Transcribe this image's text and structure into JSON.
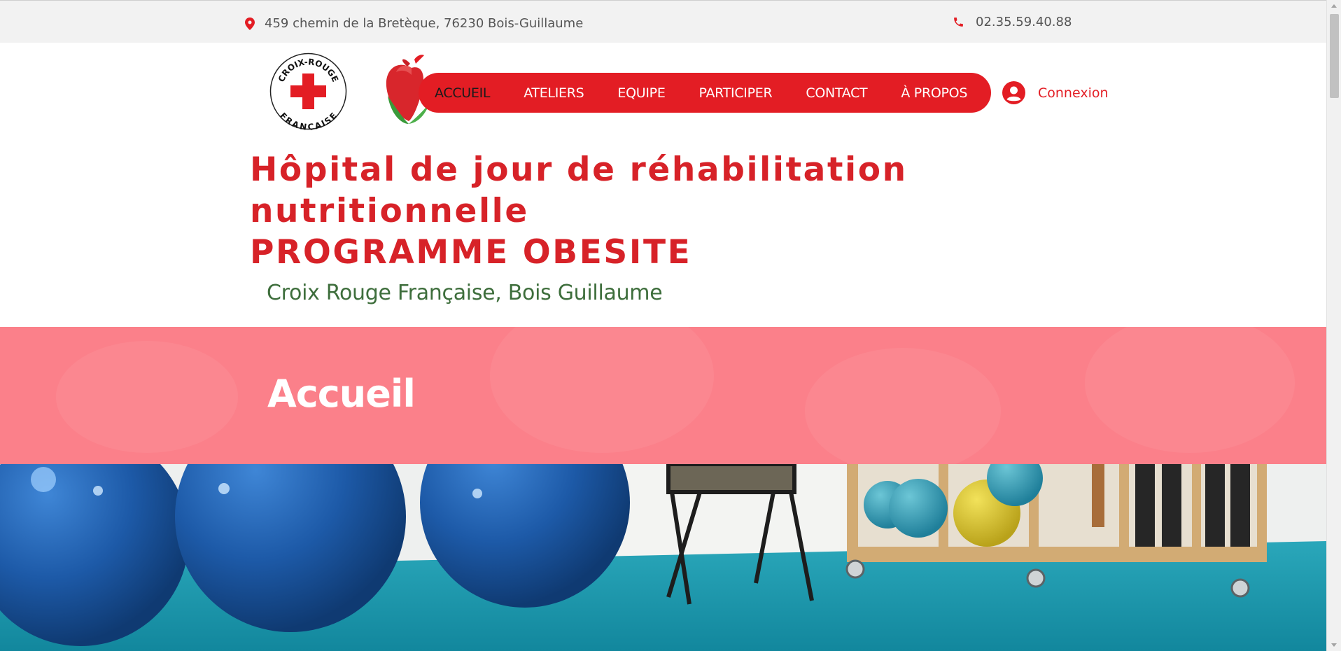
{
  "topbar": {
    "address": "459 chemin de la Bretèque, 76230 Bois-Guillaume",
    "phone": "02.35.59.40.88",
    "address_icon": "map-pin-icon",
    "phone_icon": "phone-icon"
  },
  "logo": {
    "crf_top": "CROIX-ROUGE",
    "crf_bottom": "FRANÇAISE"
  },
  "nav": {
    "items": [
      {
        "label": "ACCUEIL",
        "active": true
      },
      {
        "label": "ATELIERS",
        "active": false
      },
      {
        "label": "EQUIPE",
        "active": false
      },
      {
        "label": "PARTICIPER",
        "active": false
      },
      {
        "label": "CONTACT",
        "active": false
      },
      {
        "label": "À PROPOS",
        "active": false
      }
    ]
  },
  "login": {
    "label": "Connexion",
    "icon": "user-avatar-icon"
  },
  "header": {
    "title_line1": "Hôpital de jour de réhabilitation",
    "title_line2": "nutritionnelle",
    "title_line3": "PROGRAMME OBESITE",
    "subtitle": "Croix Rouge Française, Bois Guillaume"
  },
  "banner": {
    "heading": "Accueil"
  },
  "colors": {
    "brand_red": "#e31d24",
    "title_red": "#d72228",
    "banner_pink": "#fb808a",
    "subtitle_green": "#3e6e3c"
  }
}
